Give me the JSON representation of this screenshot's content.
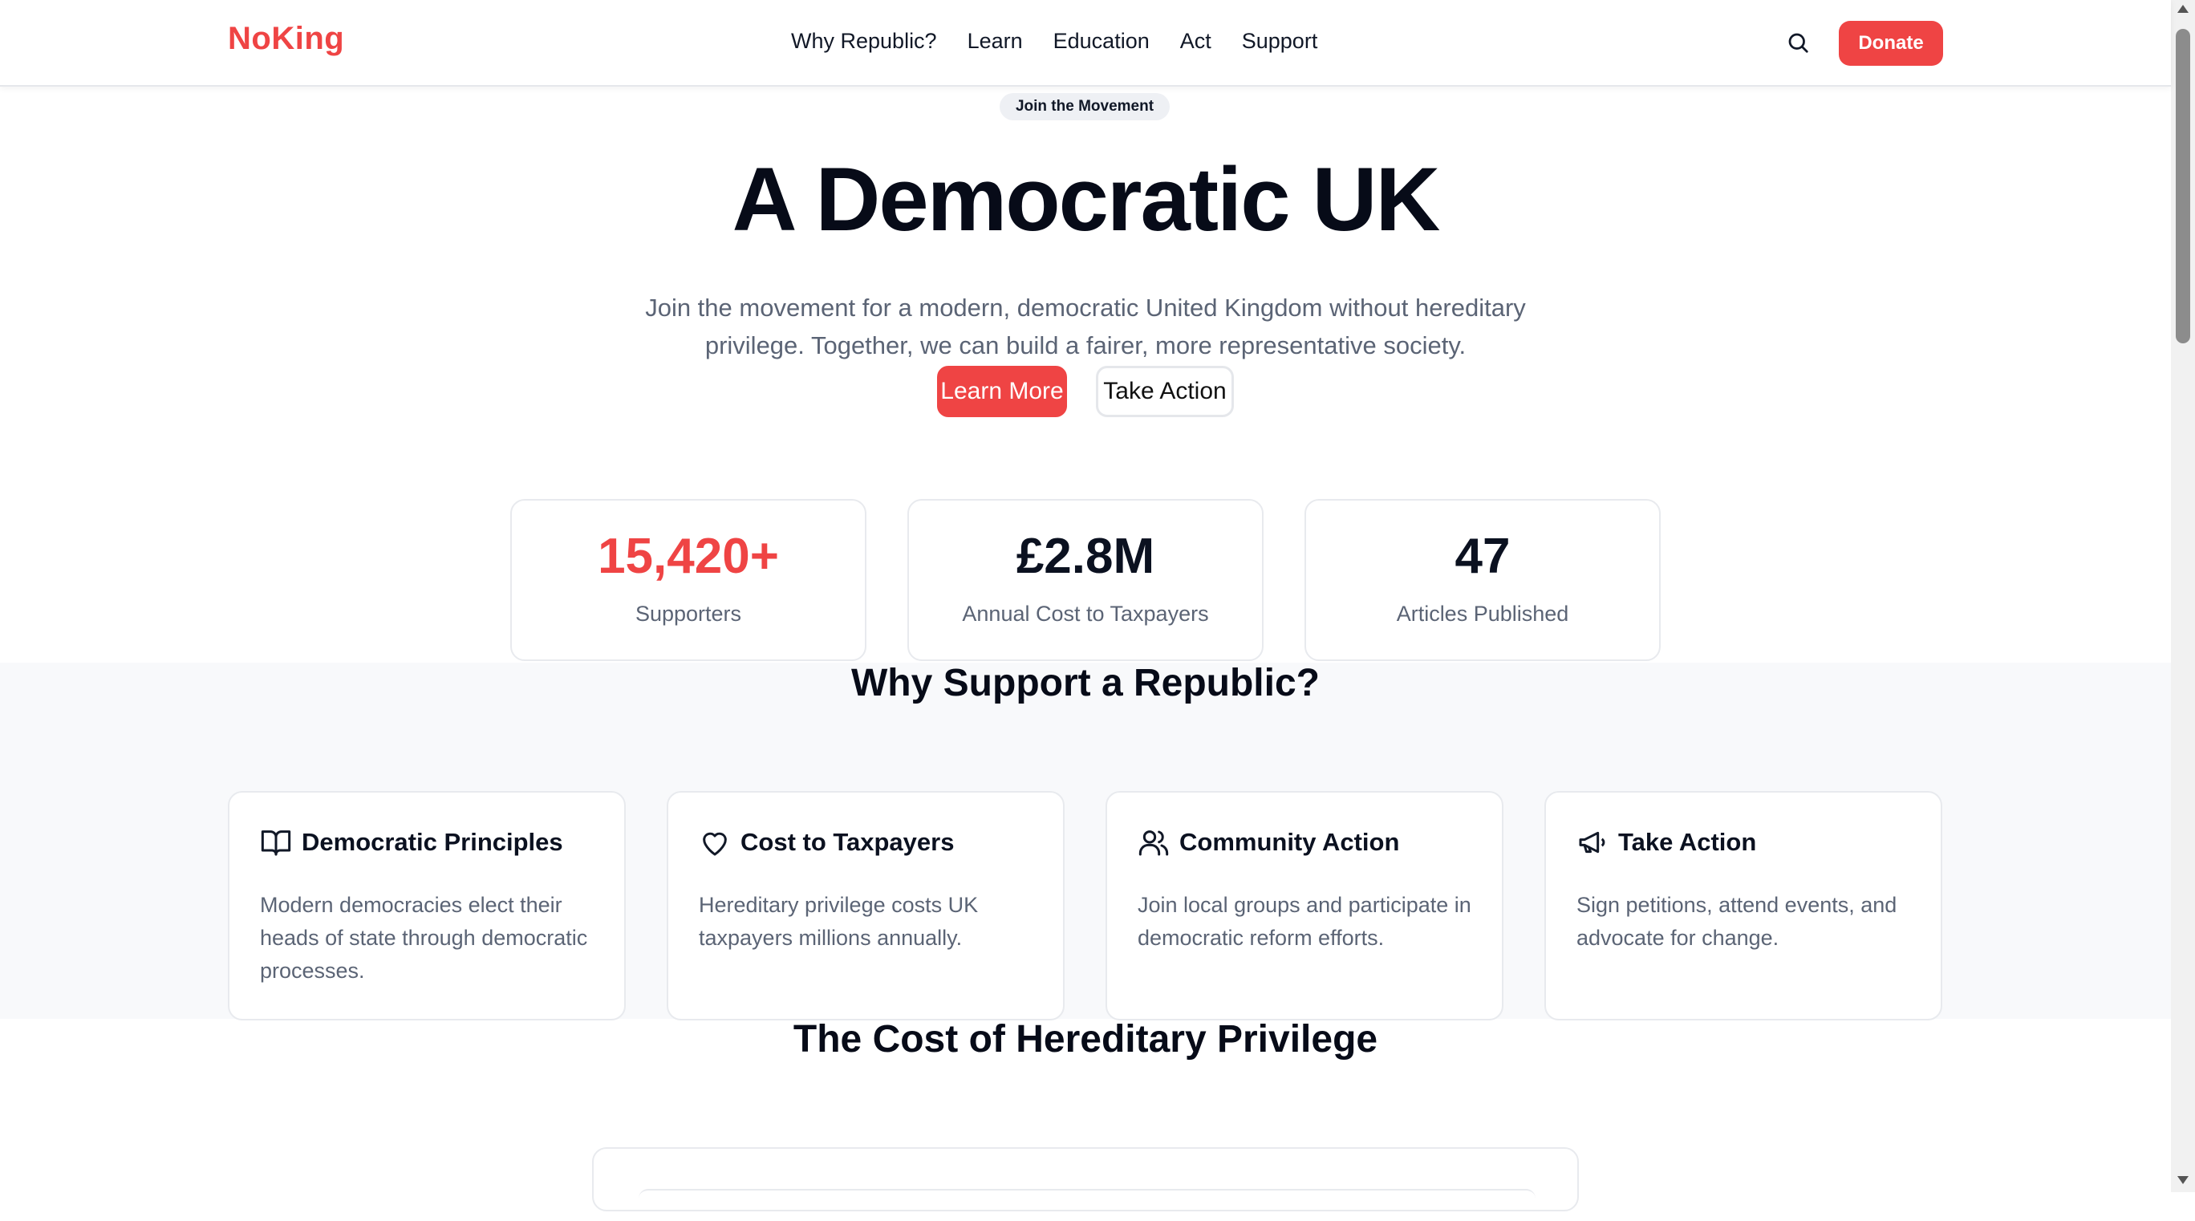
{
  "header": {
    "logo": "NoKing",
    "nav": [
      "Why Republic?",
      "Learn",
      "Education",
      "Act",
      "Support"
    ],
    "search_icon": "search-icon",
    "donate_label": "Donate"
  },
  "hero": {
    "badge": "Join the Movement",
    "title": "A Democratic UK",
    "subtitle_line1": "Join the movement for a modern, democratic United Kingdom without hereditary",
    "subtitle_line2": "privilege. Together, we can build a fairer, more representative society.",
    "primary_button": "Learn More",
    "secondary_button": "Take Action"
  },
  "stats": [
    {
      "value": "15,420+",
      "label": "Supporters"
    },
    {
      "value": "£2.8M",
      "label": "Annual Cost to Taxpayers"
    },
    {
      "value": "47",
      "label": "Articles Published"
    }
  ],
  "why": {
    "title": "Why Support a Republic?",
    "features": [
      {
        "icon": "book-open-icon",
        "title": "Democratic Principles",
        "desc": "Modern democracies elect their heads of state through democratic processes."
      },
      {
        "icon": "heart-icon",
        "title": "Cost to Taxpayers",
        "desc": "Hereditary privilege costs UK taxpayers millions annually."
      },
      {
        "icon": "users-icon",
        "title": "Community Action",
        "desc": "Join local groups and participate in democratic reform efforts."
      },
      {
        "icon": "megaphone-icon",
        "title": "Take Action",
        "desc": "Sign petitions, attend events, and advocate for change."
      }
    ]
  },
  "cost": {
    "title": "The Cost of Hereditary Privilege"
  },
  "colors": {
    "accent": "#ef4444",
    "text": "#0b1120",
    "muted": "#5b6475",
    "section_bg": "#f8f9fb"
  }
}
